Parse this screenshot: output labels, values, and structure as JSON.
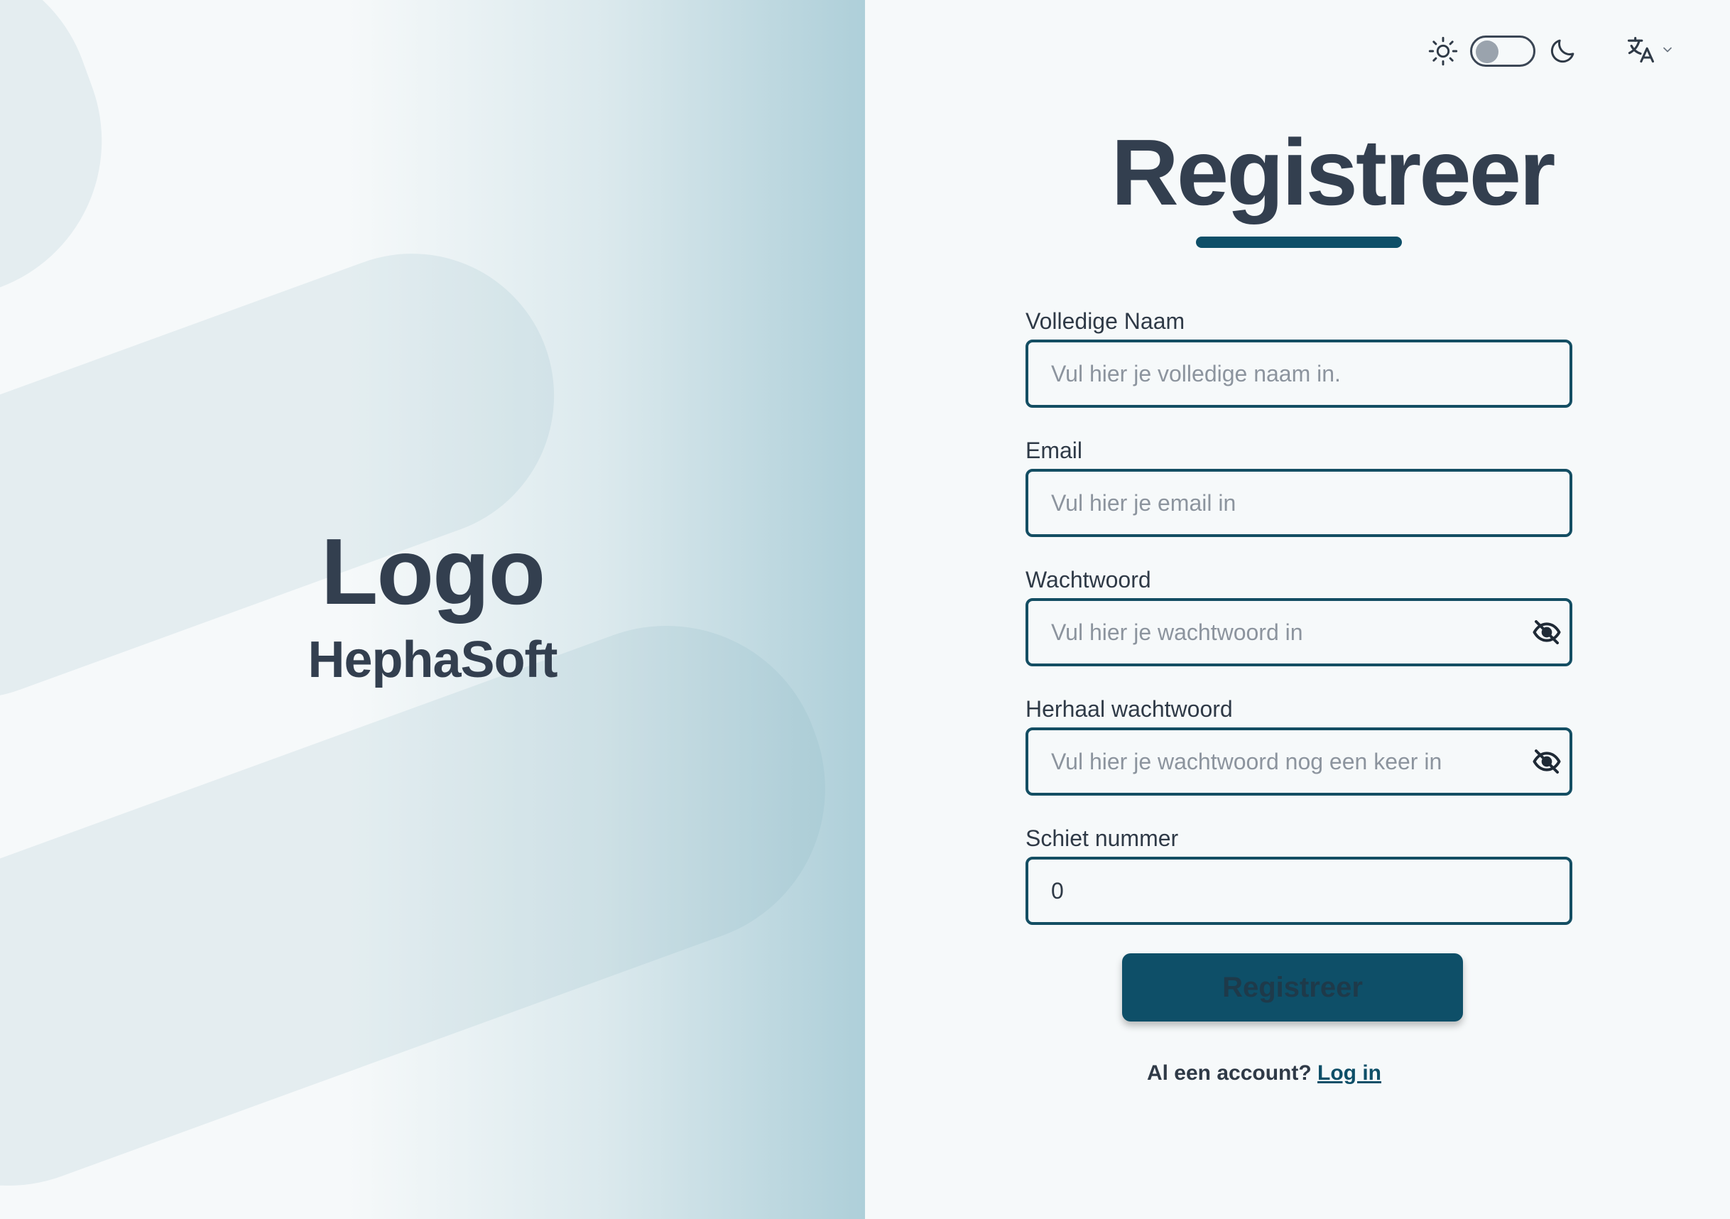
{
  "brand": {
    "logo": "Logo",
    "name": "HephaSoft"
  },
  "topbar": {
    "theme_light_icon": "sun-icon",
    "theme_dark_icon": "moon-icon",
    "theme_toggle_state": "light",
    "language_icon": "translate-icon",
    "language_chevron_icon": "chevron-down-icon"
  },
  "page": {
    "title": "Registreer"
  },
  "form": {
    "full_name": {
      "label": "Volledige Naam",
      "placeholder": "Vul hier je volledige naam in.",
      "value": ""
    },
    "email": {
      "label": "Email",
      "placeholder": "Vul hier je email in",
      "value": ""
    },
    "password": {
      "label": "Wachtwoord",
      "placeholder": "Vul hier je wachtwoord in",
      "value": "",
      "toggle_icon": "eye-off-icon"
    },
    "repeat_password": {
      "label": "Herhaal wachtwoord",
      "placeholder": "Vul hier je wachtwoord nog een keer in",
      "value": "",
      "toggle_icon": "eye-off-icon"
    },
    "shooter_number": {
      "label": "Schiet nummer",
      "value": "0"
    },
    "submit_label": "Registreer"
  },
  "footer": {
    "account_prompt": "Al een account?",
    "login_link": "Log in"
  },
  "colors": {
    "primary": "#0e4f68",
    "text": "#333f4f",
    "background": "#f6f9fa",
    "panel_accent": "#aecfd9"
  }
}
